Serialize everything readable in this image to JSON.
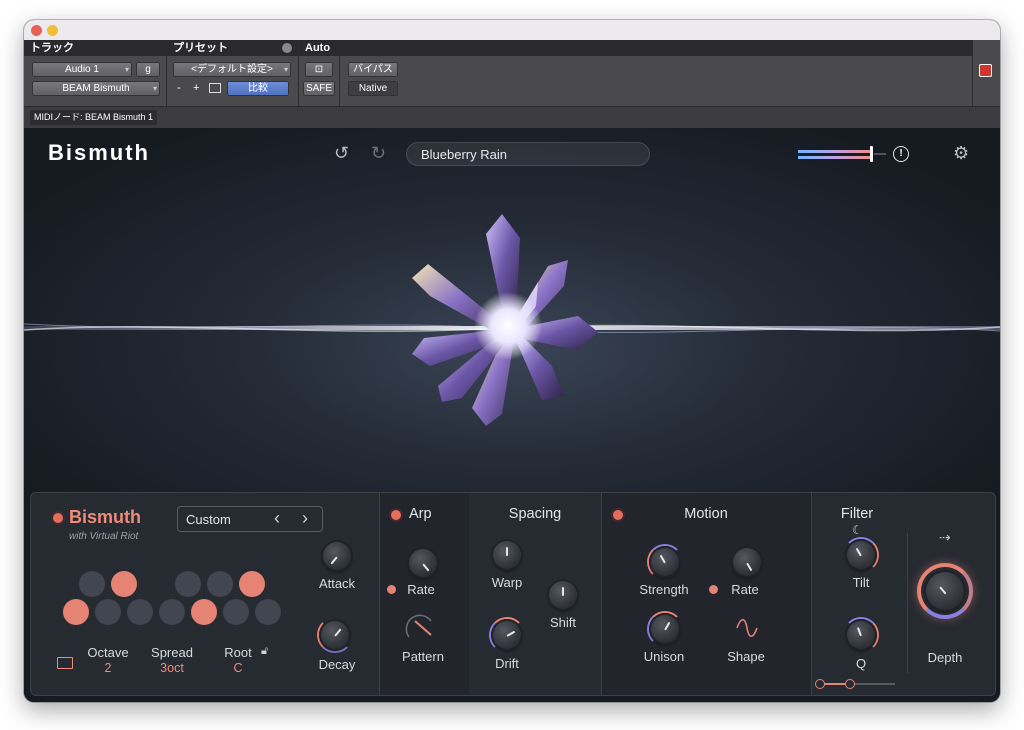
{
  "host": {
    "track_header": "トラック",
    "preset_header": "プリセット",
    "auto_header": "Auto",
    "track_name": "Audio 1",
    "track_group": "g",
    "insert_name": "BEAM Bismuth",
    "preset_value": "<デフォルト設定>",
    "preset_minus": "-",
    "preset_plus": "+",
    "compare_label": "比較",
    "safe_label": "SAFE",
    "bypass_label": "バイパス",
    "native_label": "Native",
    "midi_node": "MIDIノード: BEAM Bismuth 1"
  },
  "plugin": {
    "brand": "Bismuth",
    "preset_name": "Blueberry Rain",
    "icons": {
      "undo": "undo-icon",
      "redo": "redo-icon",
      "warning": "warning-icon",
      "settings": "gear-icon"
    },
    "accent_color": "#e58374"
  },
  "panel": {
    "title": "Bismuth",
    "subtitle": "with Virtual Riot",
    "mode_value": "Custom",
    "prev": "‹",
    "next": "›",
    "pads_row1": [
      false,
      true,
      false,
      false,
      true
    ],
    "pads_row2": [
      true,
      false,
      false,
      false,
      true,
      false,
      false
    ],
    "octave_label": "Octave",
    "octave_value": "2",
    "spread_label": "Spread",
    "spread_value": "3oct",
    "root_label": "Root",
    "root_value": "C",
    "attack_label": "Attack",
    "decay_label": "Decay",
    "arp_title": "Arp",
    "arp_rate_label": "Rate",
    "arp_pattern_label": "Pattern",
    "spacing_title": "Spacing",
    "warp_label": "Warp",
    "shift_label": "Shift",
    "drift_label": "Drift",
    "motion_title": "Motion",
    "strength_label": "Strength",
    "motion_rate_label": "Rate",
    "unison_label": "Unison",
    "shape_label": "Shape",
    "filter_title": "Filter",
    "tilt_label": "Tilt",
    "q_label": "Q",
    "depth_label": "Depth"
  }
}
